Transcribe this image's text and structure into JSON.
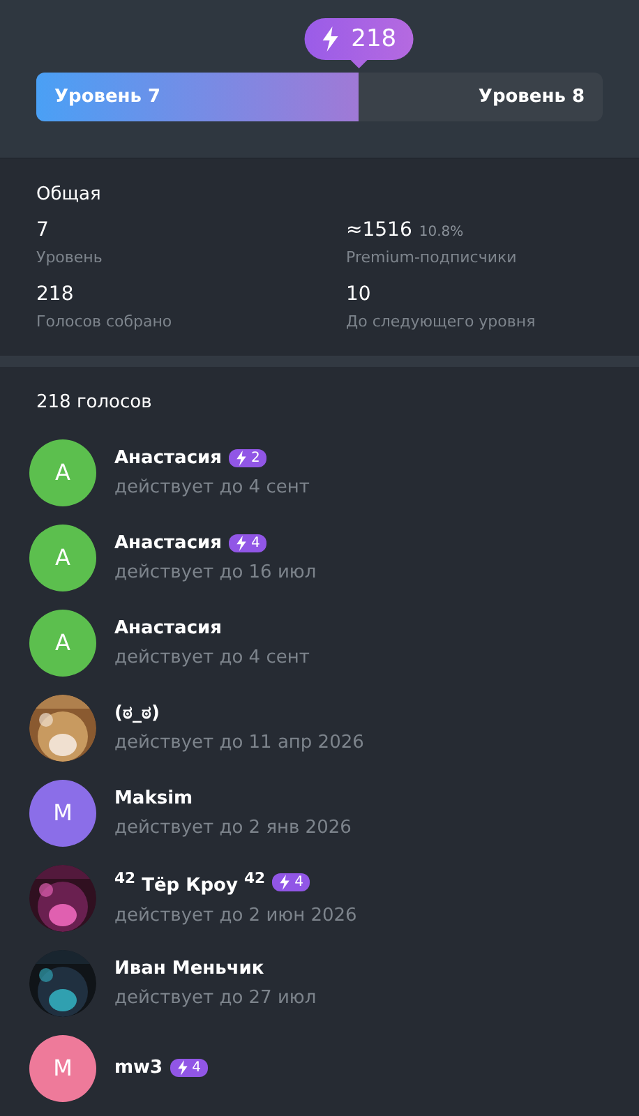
{
  "boost_badge": {
    "count": "218"
  },
  "level_bar": {
    "level": 0.57,
    "current": "Уровень 7",
    "next": "Уровень 8"
  },
  "stats": {
    "title": "Общая",
    "items": [
      {
        "value": "7",
        "label": "Уровень"
      },
      {
        "value": "≈1516",
        "extra": "10.8%",
        "label": "Premium-подписчики"
      },
      {
        "value": "218",
        "label": "Голосов собрано"
      },
      {
        "value": "10",
        "label": "До следующего уровня"
      }
    ]
  },
  "boosters": {
    "title": "218 голосов",
    "items": [
      {
        "name": "Анастасия",
        "boosts": "2",
        "expires": "действует до 4 сент",
        "avatar": {
          "kind": "letter",
          "initial": "A",
          "color": "#5cbf4e"
        }
      },
      {
        "name": "Анастасия",
        "boosts": "4",
        "expires": "действует до 16 июл",
        "avatar": {
          "kind": "letter",
          "initial": "A",
          "color": "#5cbf4e"
        }
      },
      {
        "name": "Анастасия",
        "expires": "действует до 4 сент",
        "avatar": {
          "kind": "letter",
          "initial": "A",
          "color": "#5cbf4e"
        }
      },
      {
        "name": "(ಠ_ಠ)",
        "expires": "действует до 11 апр 2026"
      },
      {
        "name": "Maksim",
        "expires": "действует до 2 янв 2026",
        "avatar": {
          "kind": "letter",
          "initial": "M",
          "color": "#8b6ee8"
        }
      },
      {
        "name": "$^{42}$ Тёр Кроу $^{42}$",
        "boosts": "4",
        "expires": "действует до 2 июн 2026"
      },
      {
        "name": "Иван Меньчик",
        "expires": "действует до 27 июл"
      },
      {
        "name": "mw3",
        "boosts": "4",
        "avatar": {
          "kind": "letter",
          "initial": "M",
          "color": "#ee7a9a"
        }
      }
    ]
  }
}
